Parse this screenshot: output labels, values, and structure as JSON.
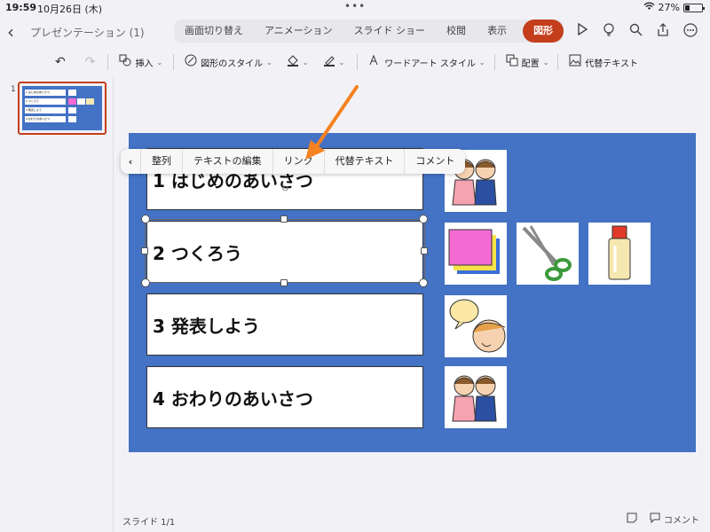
{
  "status": {
    "time": "19:59",
    "date": "10月26日 (木)",
    "dots": "•••",
    "battery": "27%",
    "battery_level": 0.27
  },
  "titlebar": {
    "back": "‹",
    "doc_title": "プレゼンテーション (1)",
    "tabs": [
      "画面切り替え",
      "アニメーション",
      "スライド ショー",
      "校閲",
      "表示",
      "図形"
    ],
    "active_tab": "図形",
    "icons": [
      "play-icon",
      "lightbulb-icon",
      "search-icon",
      "share-icon",
      "more-icon"
    ]
  },
  "ribbon": {
    "undo": "↶",
    "redo": "↷",
    "insert": "挿入",
    "shape_style": "図形のスタイル",
    "wordart_style": "ワードアート スタイル",
    "arrange": "配置",
    "alt_text": "代替テキスト"
  },
  "sidebar": {
    "slide_number": "1",
    "rows": [
      "1 はじめのあいさつ",
      "2 つくろう",
      "3 発表しよう",
      "4 おわりのあいさつ"
    ]
  },
  "slide": {
    "rows": [
      "1 はじめのあいさつ",
      "2 つくろう",
      "3 発表しよう",
      "4 おわりのあいさつ"
    ],
    "images": [
      "bowing-children",
      "colored-paper",
      "scissors",
      "glue",
      "speech-bubble-child",
      "bowing-children"
    ]
  },
  "context_menu": {
    "chevron": "‹",
    "items": [
      "整列",
      "テキストの編集",
      "リンク",
      "代替テキスト",
      "コメント"
    ]
  },
  "colors": {
    "slide_bg": "#4472c4",
    "accent": "#c43e1c",
    "arrow": "#f58220"
  },
  "footer": {
    "slide_count": "スライド 1/1",
    "comment": "コメント"
  }
}
